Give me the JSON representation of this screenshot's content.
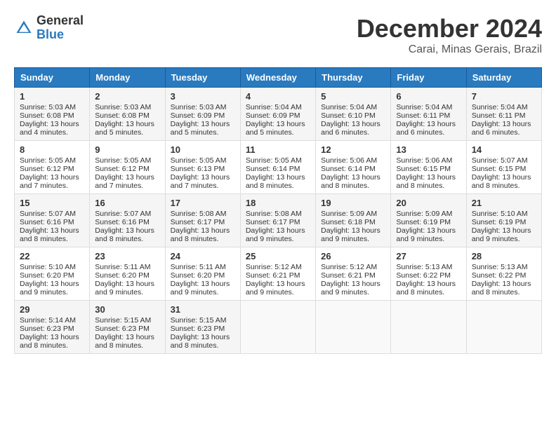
{
  "logo": {
    "general": "General",
    "blue": "Blue"
  },
  "title": "December 2024",
  "location": "Carai, Minas Gerais, Brazil",
  "days_of_week": [
    "Sunday",
    "Monday",
    "Tuesday",
    "Wednesday",
    "Thursday",
    "Friday",
    "Saturday"
  ],
  "weeks": [
    [
      {
        "day": "1",
        "sunrise": "5:03 AM",
        "sunset": "6:08 PM",
        "daylight": "13 hours and 4 minutes."
      },
      {
        "day": "2",
        "sunrise": "5:03 AM",
        "sunset": "6:08 PM",
        "daylight": "13 hours and 5 minutes."
      },
      {
        "day": "3",
        "sunrise": "5:03 AM",
        "sunset": "6:09 PM",
        "daylight": "13 hours and 5 minutes."
      },
      {
        "day": "4",
        "sunrise": "5:04 AM",
        "sunset": "6:09 PM",
        "daylight": "13 hours and 5 minutes."
      },
      {
        "day": "5",
        "sunrise": "5:04 AM",
        "sunset": "6:10 PM",
        "daylight": "13 hours and 6 minutes."
      },
      {
        "day": "6",
        "sunrise": "5:04 AM",
        "sunset": "6:11 PM",
        "daylight": "13 hours and 6 minutes."
      },
      {
        "day": "7",
        "sunrise": "5:04 AM",
        "sunset": "6:11 PM",
        "daylight": "13 hours and 6 minutes."
      }
    ],
    [
      {
        "day": "8",
        "sunrise": "5:05 AM",
        "sunset": "6:12 PM",
        "daylight": "13 hours and 7 minutes."
      },
      {
        "day": "9",
        "sunrise": "5:05 AM",
        "sunset": "6:12 PM",
        "daylight": "13 hours and 7 minutes."
      },
      {
        "day": "10",
        "sunrise": "5:05 AM",
        "sunset": "6:13 PM",
        "daylight": "13 hours and 7 minutes."
      },
      {
        "day": "11",
        "sunrise": "5:05 AM",
        "sunset": "6:14 PM",
        "daylight": "13 hours and 8 minutes."
      },
      {
        "day": "12",
        "sunrise": "5:06 AM",
        "sunset": "6:14 PM",
        "daylight": "13 hours and 8 minutes."
      },
      {
        "day": "13",
        "sunrise": "5:06 AM",
        "sunset": "6:15 PM",
        "daylight": "13 hours and 8 minutes."
      },
      {
        "day": "14",
        "sunrise": "5:07 AM",
        "sunset": "6:15 PM",
        "daylight": "13 hours and 8 minutes."
      }
    ],
    [
      {
        "day": "15",
        "sunrise": "5:07 AM",
        "sunset": "6:16 PM",
        "daylight": "13 hours and 8 minutes."
      },
      {
        "day": "16",
        "sunrise": "5:07 AM",
        "sunset": "6:16 PM",
        "daylight": "13 hours and 8 minutes."
      },
      {
        "day": "17",
        "sunrise": "5:08 AM",
        "sunset": "6:17 PM",
        "daylight": "13 hours and 8 minutes."
      },
      {
        "day": "18",
        "sunrise": "5:08 AM",
        "sunset": "6:17 PM",
        "daylight": "13 hours and 9 minutes."
      },
      {
        "day": "19",
        "sunrise": "5:09 AM",
        "sunset": "6:18 PM",
        "daylight": "13 hours and 9 minutes."
      },
      {
        "day": "20",
        "sunrise": "5:09 AM",
        "sunset": "6:19 PM",
        "daylight": "13 hours and 9 minutes."
      },
      {
        "day": "21",
        "sunrise": "5:10 AM",
        "sunset": "6:19 PM",
        "daylight": "13 hours and 9 minutes."
      }
    ],
    [
      {
        "day": "22",
        "sunrise": "5:10 AM",
        "sunset": "6:20 PM",
        "daylight": "13 hours and 9 minutes."
      },
      {
        "day": "23",
        "sunrise": "5:11 AM",
        "sunset": "6:20 PM",
        "daylight": "13 hours and 9 minutes."
      },
      {
        "day": "24",
        "sunrise": "5:11 AM",
        "sunset": "6:20 PM",
        "daylight": "13 hours and 9 minutes."
      },
      {
        "day": "25",
        "sunrise": "5:12 AM",
        "sunset": "6:21 PM",
        "daylight": "13 hours and 9 minutes."
      },
      {
        "day": "26",
        "sunrise": "5:12 AM",
        "sunset": "6:21 PM",
        "daylight": "13 hours and 9 minutes."
      },
      {
        "day": "27",
        "sunrise": "5:13 AM",
        "sunset": "6:22 PM",
        "daylight": "13 hours and 8 minutes."
      },
      {
        "day": "28",
        "sunrise": "5:13 AM",
        "sunset": "6:22 PM",
        "daylight": "13 hours and 8 minutes."
      }
    ],
    [
      {
        "day": "29",
        "sunrise": "5:14 AM",
        "sunset": "6:23 PM",
        "daylight": "13 hours and 8 minutes."
      },
      {
        "day": "30",
        "sunrise": "5:15 AM",
        "sunset": "6:23 PM",
        "daylight": "13 hours and 8 minutes."
      },
      {
        "day": "31",
        "sunrise": "5:15 AM",
        "sunset": "6:23 PM",
        "daylight": "13 hours and 8 minutes."
      },
      null,
      null,
      null,
      null
    ]
  ]
}
